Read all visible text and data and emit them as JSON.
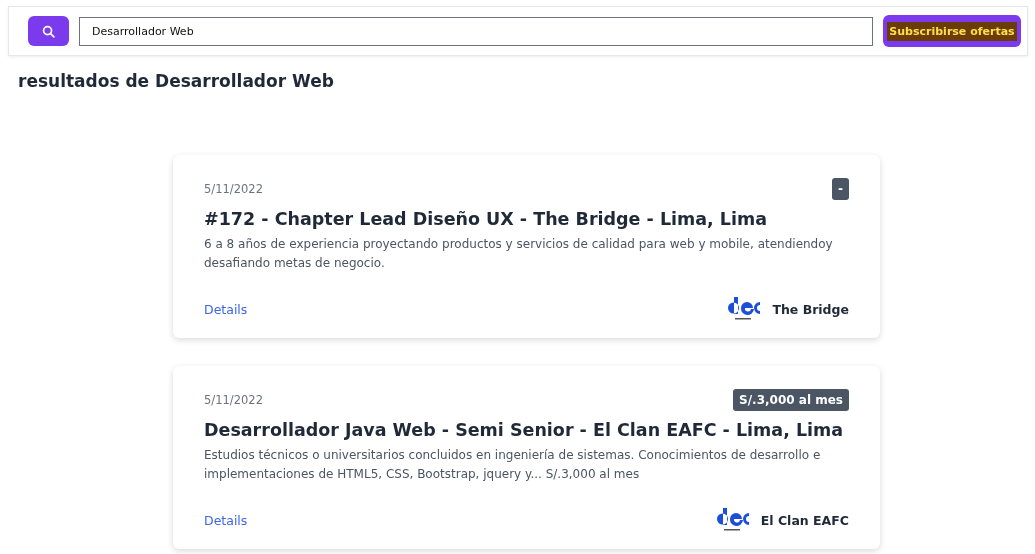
{
  "search": {
    "value": "Desarrollador Web"
  },
  "subscribe_button": "Subscribirse ofertas",
  "results_heading": "resultados de Desarrollador Web",
  "jobs": [
    {
      "date": "5/11/2022",
      "badge": "-",
      "title": "#172 - Chapter Lead Diseño UX - The Bridge - Lima, Lima",
      "description": "6 a 8 años de experiencia proyectando productos y servicios de calidad para web y mobile, atendiendoy desafiando metas de negocio.",
      "link": "Details",
      "company": "The Bridge"
    },
    {
      "date": "5/11/2022",
      "badge": "S/.3,000 al mes",
      "title": "Desarrollador Java Web - Semi Senior - El Clan EAFC - Lima, Lima",
      "description": "Estudios técnicos o universitarios concluidos en ingeniería de sistemas. Conocimientos de desarrollo e implementaciones de HTML5, CSS, Bootstrap, jquery y... S/.3,000 al mes",
      "link": "Details",
      "company": "El Clan EAFC"
    }
  ]
}
